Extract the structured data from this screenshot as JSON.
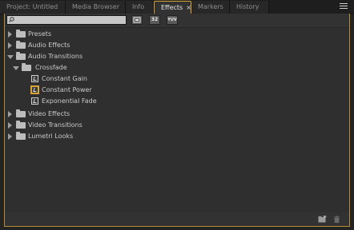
{
  "tabs": [
    {
      "label": "Project: Untitled",
      "active": false
    },
    {
      "label": "Media Browser",
      "active": false
    },
    {
      "label": "Info",
      "active": false
    },
    {
      "label": "Effects",
      "active": true
    },
    {
      "label": "Markers",
      "active": false
    },
    {
      "label": "History",
      "active": false
    }
  ],
  "tab_close_glyph": "×",
  "search": {
    "value": "",
    "placeholder": ""
  },
  "toolbar": {
    "accelerated_label": "",
    "bit32_label": "32",
    "yuv_label": "YUV"
  },
  "tree": [
    {
      "label": "Presets",
      "level": 0,
      "type": "folder",
      "expanded": false
    },
    {
      "label": "Audio Effects",
      "level": 0,
      "type": "folder",
      "expanded": false
    },
    {
      "label": "Audio Transitions",
      "level": 0,
      "type": "folder",
      "expanded": true
    },
    {
      "label": "Crossfade",
      "level": 1,
      "type": "folder",
      "expanded": true
    },
    {
      "label": "Constant Gain",
      "level": 2,
      "type": "effect",
      "default": false
    },
    {
      "label": "Constant Power",
      "level": 2,
      "type": "effect",
      "default": true
    },
    {
      "label": "Exponential Fade",
      "level": 2,
      "type": "effect",
      "default": false
    },
    {
      "label": "Video Effects",
      "level": 0,
      "type": "folder",
      "expanded": false
    },
    {
      "label": "Video Transitions",
      "level": 0,
      "type": "folder",
      "expanded": false
    },
    {
      "label": "Lumetri Looks",
      "level": 0,
      "type": "folder",
      "expanded": false
    }
  ],
  "colors": {
    "accent": "#d9a53a",
    "panel_bg": "#323232",
    "text": "#c9c9c9"
  }
}
